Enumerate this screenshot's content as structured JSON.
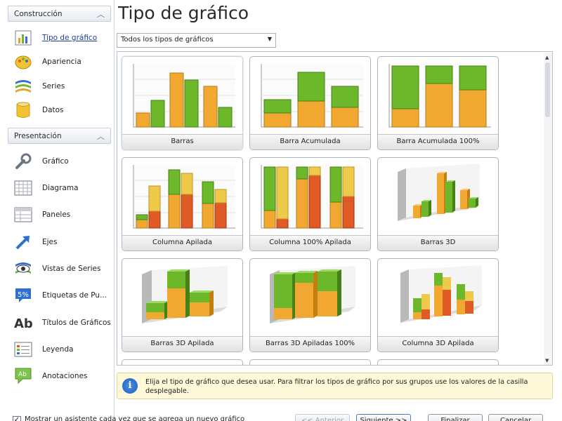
{
  "sidebar": {
    "group1": "Construcción",
    "group1_items": [
      {
        "label": "Tipo de gráfico",
        "icon": "bar-chart-icon",
        "active": true
      },
      {
        "label": "Apariencia",
        "icon": "palette-icon"
      },
      {
        "label": "Series",
        "icon": "series-layers-icon"
      },
      {
        "label": "Datos",
        "icon": "database-icon"
      }
    ],
    "group2": "Presentación",
    "group2_items": [
      {
        "label": "Gráfico",
        "icon": "wrench-icon"
      },
      {
        "label": "Diagrama",
        "icon": "grid-diagram-icon"
      },
      {
        "label": "Paneles",
        "icon": "panels-icon"
      },
      {
        "label": "Ejes",
        "icon": "axis-arrow-icon"
      },
      {
        "label": "Vistas de Series",
        "icon": "eye-series-icon"
      },
      {
        "label": "Etiquetas de Pu...",
        "icon": "percent-label-icon"
      },
      {
        "label": "Títulos de Gráficos",
        "icon": "ab-text-icon"
      },
      {
        "label": "Leyenda",
        "icon": "legend-list-icon"
      },
      {
        "label": "Anotaciones",
        "icon": "annotation-bubble-icon"
      }
    ]
  },
  "main": {
    "title": "Tipo de gráfico",
    "filter_value": "Todos los tipos de gráficos",
    "tiles": [
      {
        "label": "Barras"
      },
      {
        "label": "Barra Acumulada"
      },
      {
        "label": "Barra Acumulada 100%"
      },
      {
        "label": "Columna Apilada"
      },
      {
        "label": "Columna 100% Apilada"
      },
      {
        "label": "Barras 3D"
      },
      {
        "label": "Barras 3D Apilada"
      },
      {
        "label": "Barras 3D Apiladas 100%"
      },
      {
        "label": "Columna 3D Apilada"
      }
    ],
    "hint": "Elija el tipo de gráfico que desea usar. Para filtrar los tipos de gráfico por sus grupos use los valores de la casilla desplegable."
  },
  "footer": {
    "checkbox_label": "Mostrar un asistente cada vez que se agrega un nuevo gráfico",
    "checked": true,
    "back": "<< Anterior",
    "next": "Siguiente >>",
    "finish": "Finalizar",
    "cancel": "Cancelar"
  },
  "colors": {
    "orange": "#f0a830",
    "green": "#6cb82a",
    "red": "#e05a25",
    "yellow": "#eec94a",
    "accent": "#1b3f9a"
  }
}
